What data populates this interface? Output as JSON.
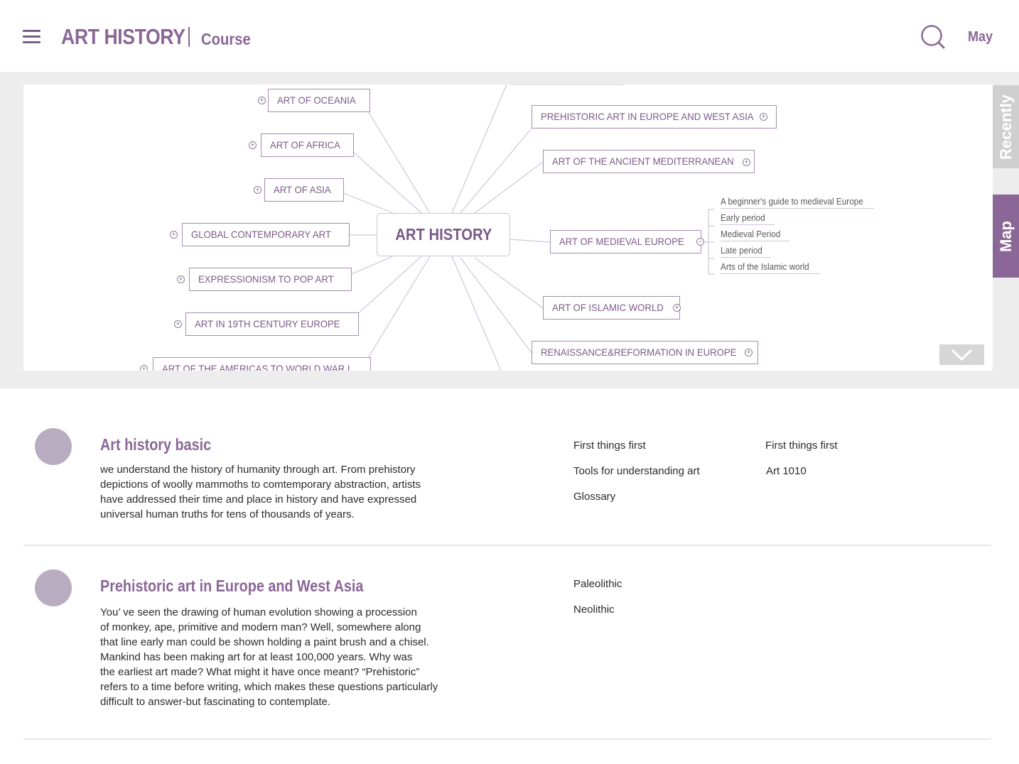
{
  "header": {
    "brand": "ART HISTORY",
    "sub": "Course",
    "user": "May"
  },
  "side_tabs": {
    "recently": "Recently",
    "map": "Map"
  },
  "map": {
    "center": "ART HISTORY",
    "left_nodes": [
      "ART OF OCEANIA",
      "ART OF AFRICA",
      "ART OF ASIA",
      "GLOBAL CONTEMPORARY ART",
      "EXPRESSIONISM TO POP ART",
      "ART IN 19TH CENTURY EUROPE",
      "ART OF THE AMERICAS TO WORLD WAR I"
    ],
    "right_nodes": [
      "PREHISTORIC ART IN EUROPE AND WEST ASIA",
      "ART OF THE ANCIENT MEDITERRANEAN",
      "ART OF MEDIEVAL EUROPE",
      "ART OF ISLAMIC WORLD",
      "RENAISSANCE&REFORMATION IN EUROPE"
    ],
    "medieval_children": [
      "A beginner's guide to medieval Europe",
      "Early period",
      "Medieval Period",
      "Late period",
      "Arts of the Islamic world"
    ]
  },
  "sections": [
    {
      "title": "Art history basic",
      "desc": [
        "we understand the history of humanity through art. From prehistory",
        "depictions of woolly mammoths to comtemporary abstraction, artists",
        "have addressed their time and place in history and have expressed",
        "universal human truths for tens of thousands of years."
      ],
      "links_col1": [
        "First things first",
        "Tools for understanding art",
        "Glossary"
      ],
      "links_col2": [
        "First things first",
        "Art 1010"
      ]
    },
    {
      "title": "Prehistoric art in Europe and West Asia",
      "desc": [
        "You’ ve seen the drawing of human evolution showing a procession",
        "of monkey, ape, primitive and modern man? Well, somewhere along",
        "that line early man could be shown holding a paint brush and a chisel.",
        "Mankind has been making art for at least 100,000 years. Why  was",
        "the earliest art made? What might it have once meant?  “Prehistoric”",
        "refers to a time before writing, which makes these questions particularly",
        "difficult to answer-but fascinating to contemplate."
      ],
      "links_col1": [
        "Paleolithic",
        "Neolithic"
      ]
    }
  ]
}
